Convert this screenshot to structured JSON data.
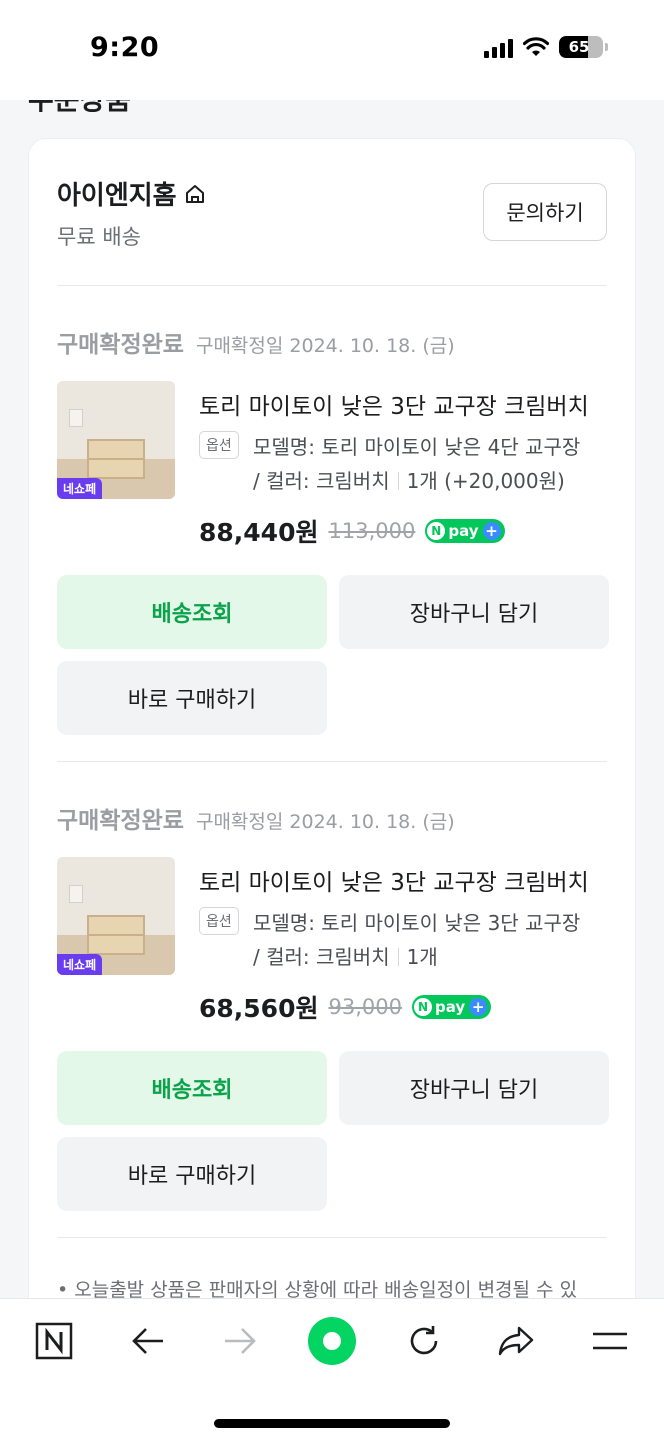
{
  "status_bar": {
    "time": "9:20",
    "battery": "65",
    "battery_level": 0.65
  },
  "page": {
    "section_title_cut": "주문상품"
  },
  "seller": {
    "name": "아이엔지홈",
    "shipping": "무료 배송",
    "inquiry_label": "문의하기"
  },
  "orders": [
    {
      "status": "구매확정완료",
      "date": "구매확정일 2024. 10. 18. (금)",
      "badge": "네쇼페",
      "title": "토리 마이토이 낮은 3단 교구장 크림버치",
      "option_tag": "옵션",
      "option_line1": "모델명: 토리 마이토이 낮은 4단 교구장",
      "option_color": "/ 컬러: 크림버치",
      "option_qty": "1개 (+20,000원)",
      "price": "88,440원",
      "original_price": "113,000",
      "npay": "pay",
      "btn_track": "배송조회",
      "btn_cart": "장바구니 담기",
      "btn_buy": "바로 구매하기"
    },
    {
      "status": "구매확정완료",
      "date": "구매확정일 2024. 10. 18. (금)",
      "badge": "네쇼페",
      "title": "토리 마이토이 낮은 3단 교구장 크림버치",
      "option_tag": "옵션",
      "option_line1": "모델명: 토리 마이토이 낮은 3단 교구장",
      "option_color": "/ 컬러: 크림버치",
      "option_qty": "1개",
      "price": "68,560원",
      "original_price": "93,000",
      "npay": "pay",
      "btn_track": "배송조회",
      "btn_cart": "장바구니 담기",
      "btn_buy": "바로 구매하기"
    }
  ],
  "footer_note": "• 오늘출발 상품은 판매자의 상황에 따라 배송일정이 변경될 수 있",
  "toolbar": {
    "items": [
      "naver-home-icon",
      "back-arrow-icon",
      "forward-arrow-icon",
      "green-dot-icon",
      "refresh-icon",
      "share-icon",
      "menu-icon"
    ]
  },
  "colors": {
    "accent_green": "#03c75a",
    "track_bg": "#e3f8e9",
    "badge_purple": "#6a3cf0"
  }
}
